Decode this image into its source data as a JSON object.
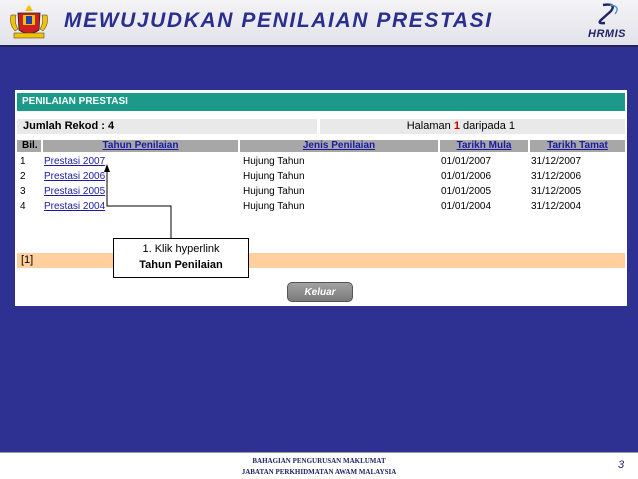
{
  "header": {
    "title": "MEWUJUDKAN PENILAIAN PRESTASI",
    "brand": "HRMIS"
  },
  "panel": {
    "title": "PENILAIAN PRESTASI",
    "record_count": "Jumlah Rekod : 4",
    "page_prefix": "Halaman",
    "page_current": "1",
    "page_suffix": "daripada 1",
    "columns": [
      "Bil.",
      "Tahun Penilaian",
      "Jenis Penilaian",
      "Tarikh Mula",
      "Tarikh Tamat"
    ],
    "rows": [
      {
        "bil": "1",
        "tahun": "Prestasi 2007",
        "jenis": "Hujung Tahun",
        "mula": "01/01/2007",
        "tamat": "31/12/2007"
      },
      {
        "bil": "2",
        "tahun": "Prestasi 2006",
        "jenis": "Hujung Tahun",
        "mula": "01/01/2006",
        "tamat": "31/12/2006"
      },
      {
        "bil": "3",
        "tahun": "Prestasi 2005",
        "jenis": "Hujung Tahun",
        "mula": "01/01/2005",
        "tamat": "31/12/2005"
      },
      {
        "bil": "4",
        "tahun": "Prestasi 2004",
        "jenis": "Hujung Tahun",
        "mula": "01/01/2004",
        "tamat": "31/12/2004"
      }
    ],
    "pager": "[1]",
    "exit_label": "Keluar"
  },
  "callout": {
    "line1": "1. Klik hyperlink",
    "line2": "Tahun Penilaian"
  },
  "footer": {
    "line1": "BAHAGIAN PENGURUSAN MAKLUMAT",
    "line2": "JABATAN PERKHIDMATAN AWAM MALAYSIA",
    "page_number": "3"
  },
  "colors": {
    "background": "#2e3192",
    "panel_title": "#1b9a8a",
    "header_row": "#a7a7a7",
    "pager_row": "#ffcf9d",
    "link": "#1a1aa3"
  },
  "icons": [
    "malaysia-crest-icon",
    "hrmis-logo-icon"
  ]
}
